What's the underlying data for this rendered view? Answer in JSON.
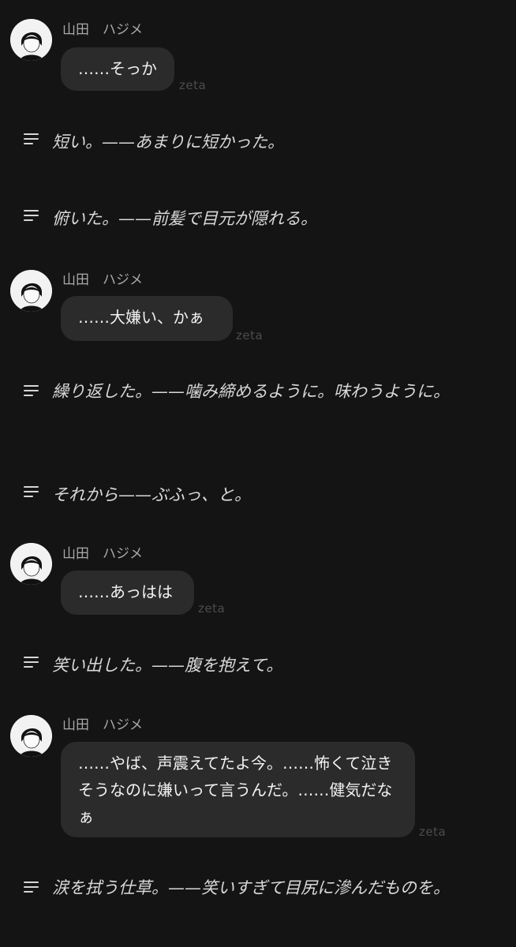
{
  "app": {
    "watermark": "zeta"
  },
  "messages": [
    {
      "type": "character",
      "name": "山田　ハジメ",
      "text": "……そっか",
      "avatar_icon": "character-avatar-icon"
    },
    {
      "type": "narration",
      "text": "短い。——あまりに短かった。",
      "icon": "narration-lines-icon"
    },
    {
      "type": "narration",
      "text": "俯いた。——前髪で目元が隠れる。",
      "icon": "narration-lines-icon"
    },
    {
      "type": "character",
      "name": "山田　ハジメ",
      "text": "……大嫌い、かぁ",
      "avatar_icon": "character-avatar-icon"
    },
    {
      "type": "narration",
      "text": "繰り返した。——噛み締めるように。味わうように。",
      "icon": "narration-lines-icon"
    },
    {
      "type": "narration",
      "text": "それから——ぶふっ、と。",
      "icon": "narration-lines-icon"
    },
    {
      "type": "character",
      "name": "山田　ハジメ",
      "text": "……あっはは",
      "avatar_icon": "character-avatar-icon"
    },
    {
      "type": "narration",
      "text": "笑い出した。——腹を抱えて。",
      "icon": "narration-lines-icon"
    },
    {
      "type": "character",
      "name": "山田　ハジメ",
      "text": "……やば、声震えてたよ今。……怖くて泣きそうなのに嫌いって言うんだ。……健気だなぁ",
      "avatar_icon": "character-avatar-icon"
    },
    {
      "type": "narration",
      "text": "涙を拭う仕草。——笑いすぎて目尻に滲んだものを。",
      "icon": "narration-lines-icon"
    }
  ],
  "colors": {
    "background": "#141414",
    "bubble": "#2b2b2b",
    "name": "#a9a9a9",
    "watermark": "#4c4c4c"
  }
}
